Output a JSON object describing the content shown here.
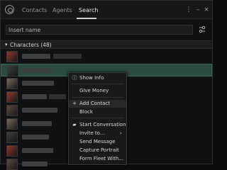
{
  "tabs": [
    {
      "label": "Contacts"
    },
    {
      "label": "Agents"
    },
    {
      "label": "Search"
    }
  ],
  "search": {
    "placeholder": "Insert name"
  },
  "section": {
    "title": "Characters (48)"
  },
  "context_menu": {
    "items": [
      {
        "label": "Show Info",
        "icon": "info-icon"
      },
      {
        "label": "Give Money"
      },
      {
        "label": "Add Contact",
        "icon": "plus-icon"
      },
      {
        "label": "Block"
      },
      {
        "label": "Start Conversation",
        "icon": "chat-icon"
      },
      {
        "label": "Invite to...",
        "has_submenu": true
      },
      {
        "label": "Send Message"
      },
      {
        "label": "Capture Portrait"
      },
      {
        "label": "Form Fleet With..."
      }
    ]
  },
  "colors": {
    "selected_row": "#2c4a43",
    "background": "#0f1112"
  }
}
